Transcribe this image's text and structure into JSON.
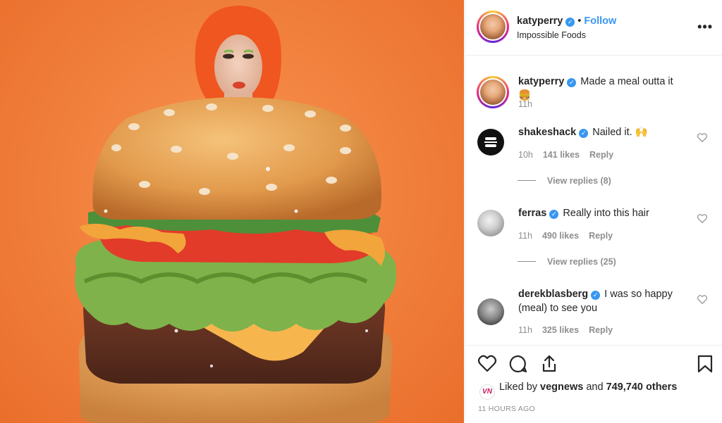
{
  "post": {
    "author": "katyperry",
    "follow_label": "Follow",
    "dot": "•",
    "location": "Impossible Foods",
    "more_label": "•••"
  },
  "caption": {
    "user": "katyperry",
    "text": "Made a meal outta it 🍔",
    "time": "11h"
  },
  "comments": [
    {
      "user": "shakeshack",
      "text": "Nailed it. 🙌",
      "time": "10h",
      "likes": "141 likes",
      "reply": "Reply",
      "view_replies": "View replies (8)"
    },
    {
      "user": "ferras",
      "text": "Really into this hair",
      "time": "11h",
      "likes": "490 likes",
      "reply": "Reply",
      "view_replies": "View replies (25)"
    },
    {
      "user": "derekblasberg",
      "text": "I was so happy (meal) to see you",
      "time": "11h",
      "likes": "325 likes",
      "reply": "Reply"
    }
  ],
  "likes": {
    "prefix": "Liked by",
    "user": "vegnews",
    "joiner": "and",
    "count": "749,740 others",
    "logo_text": "VN"
  },
  "timestamp": "11 HOURS AGO",
  "icons": {
    "verified": "verified-badge-icon",
    "like": "heart-icon",
    "comment": "comment-bubble-icon",
    "share": "share-icon",
    "save": "bookmark-icon",
    "more": "more-options-icon"
  },
  "colors": {
    "accent": "#3897f0",
    "meta": "#8e8e8e",
    "text": "#262626",
    "background_orange": "#f2823f"
  }
}
